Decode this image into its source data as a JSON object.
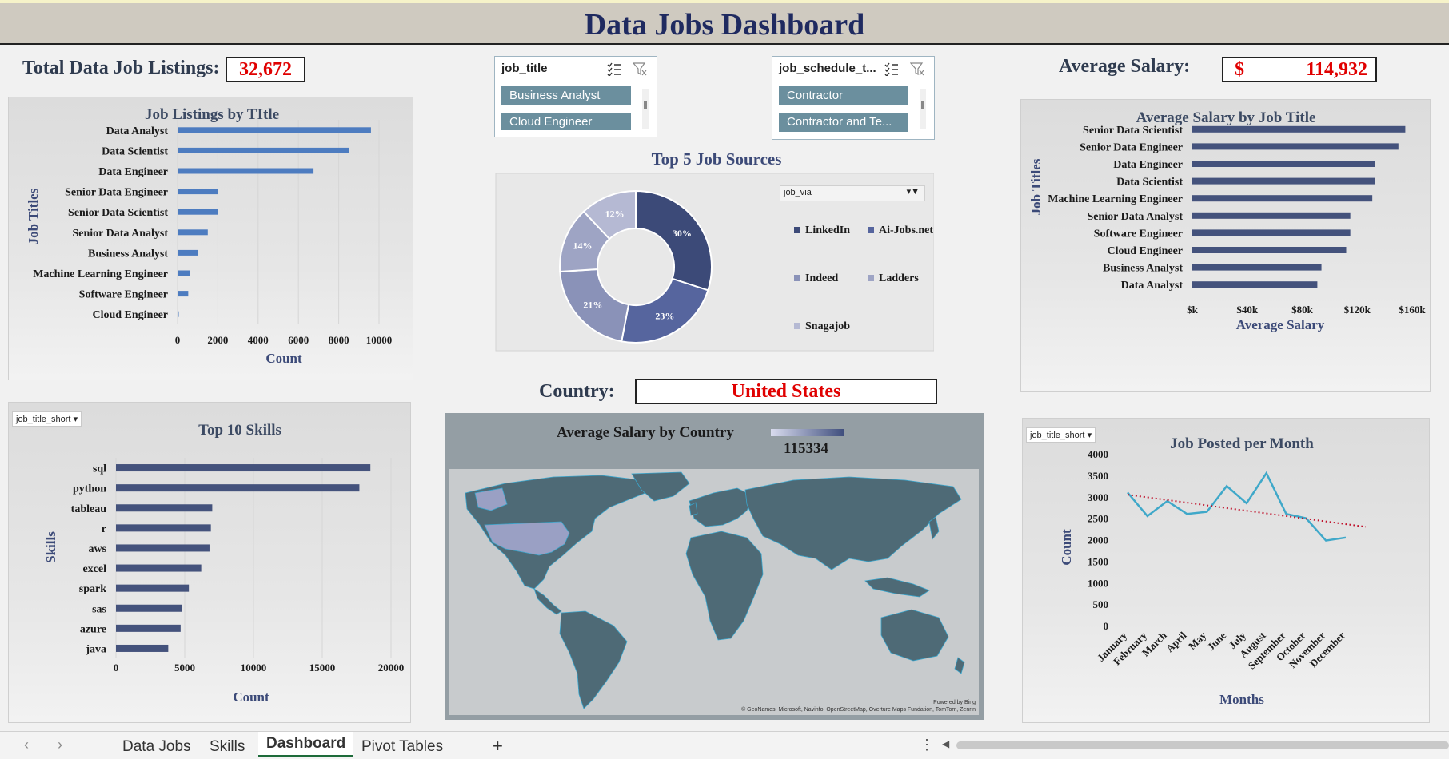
{
  "dashboard_title": "Data Jobs Dashboard",
  "kpis": {
    "total_label": "Total Data Job Listings:",
    "total_value": "32,672",
    "avg_salary_label": "Average Salary:",
    "avg_salary_currency": "$",
    "avg_salary_value": "114,932",
    "country_label": "Country:",
    "country_value": "United States"
  },
  "slicers": {
    "job_title": {
      "header": "job_title",
      "items": [
        "Business Analyst",
        "Cloud Engineer"
      ]
    },
    "job_schedule": {
      "header": "job_schedule_t...",
      "items": [
        "Contractor",
        "Contractor and Te..."
      ]
    }
  },
  "filter_chips": {
    "job_via": "job_via",
    "skills_filter": "job_title_short",
    "month_filter": "job_title_short"
  },
  "map_panel": {
    "title": "Average Salary by Country",
    "legend_value": "115334",
    "credit_1": "Powered by Bing",
    "credit_2": "© GeoNames, Microsoft, Navinfo, OpenStreetMap, Overture Maps Fundation, TomTom, Zenrin"
  },
  "tabs": [
    "Data Jobs",
    "Skills",
    "Dashboard",
    "Pivot Tables"
  ],
  "active_tab": "Dashboard",
  "new_sheet_label": "+",
  "colors": {
    "bar": "#4d7cc0",
    "bar_dark": "#44527c",
    "accent_red": "#e00000",
    "title_navy": "#1f2a60",
    "slicer_item": "#6b8f9e",
    "map_land": "#4e6a76",
    "map_highlight": "#9aa0c4",
    "line": "#3fa8c9",
    "trend": "#c0102a"
  },
  "chart_data": [
    {
      "id": "job_listings_by_title",
      "type": "bar",
      "orientation": "horizontal",
      "title": "Job Listings by TItle",
      "xlabel": "Count",
      "ylabel": "Job Titles",
      "categories": [
        "Data Analyst",
        "Data Scientist",
        "Data Engineer",
        "Senior Data Engineer",
        "Senior Data Scientist",
        "Senior Data Analyst",
        "Business Analyst",
        "Machine Learning Engineer",
        "Software Engineer",
        "Cloud Engineer"
      ],
      "values": [
        9600,
        8500,
        6750,
        2000,
        2000,
        1500,
        1000,
        600,
        530,
        50
      ],
      "xticks": [
        "0",
        "2000",
        "4000",
        "6000",
        "8000",
        "10000"
      ],
      "xlim": [
        0,
        10000
      ]
    },
    {
      "id": "top_10_skills",
      "type": "bar",
      "orientation": "horizontal",
      "title": "Top 10 Skills",
      "xlabel": "Count",
      "ylabel": "Skills",
      "categories": [
        "sql",
        "python",
        "tableau",
        "r",
        "aws",
        "excel",
        "spark",
        "sas",
        "azure",
        "java"
      ],
      "values": [
        18500,
        17700,
        7000,
        6900,
        6800,
        6200,
        5300,
        4800,
        4700,
        3800
      ],
      "xticks": [
        "0",
        "5000",
        "10000",
        "15000",
        "20000"
      ],
      "xlim": [
        0,
        20000
      ]
    },
    {
      "id": "top_5_job_sources",
      "type": "pie",
      "donut": true,
      "title": "Top 5 Job Sources",
      "categories": [
        "LinkedIn",
        "Ai-Jobs.net",
        "Indeed",
        "Ladders",
        "Snagajob"
      ],
      "values": [
        30,
        23,
        21,
        14,
        12
      ],
      "labels": [
        "30%",
        "23%",
        "21%",
        "14%",
        "12%"
      ],
      "colors": [
        "#3c4a78",
        "#56659e",
        "#8a92b8",
        "#9ea4c4",
        "#b5b9d3"
      ],
      "legend": "right"
    },
    {
      "id": "avg_salary_by_title",
      "type": "bar",
      "orientation": "horizontal",
      "title": "Average Salary by Job Title",
      "xlabel": "Average Salary",
      "ylabel": "Job Titles",
      "categories": [
        "Senior Data Scientist",
        "Senior Data Engineer",
        "Data Engineer",
        "Data Scientist",
        "Machine Learning Engineer",
        "Senior Data Analyst",
        "Software Engineer",
        "Cloud Engineer",
        "Business Analyst",
        "Data Analyst"
      ],
      "values": [
        155000,
        150000,
        133000,
        133000,
        131000,
        115000,
        115000,
        112000,
        94000,
        91000
      ],
      "xticks": [
        "$k",
        "$40k",
        "$80k",
        "$120k",
        "$160k"
      ],
      "xlim": [
        0,
        160000
      ]
    },
    {
      "id": "jobs_posted_per_month",
      "type": "line",
      "title": "Job Posted per Month",
      "xlabel": "Months",
      "ylabel": "Count",
      "categories": [
        "January",
        "February",
        "March",
        "April",
        "May",
        "June",
        "July",
        "August",
        "September",
        "October",
        "November",
        "December"
      ],
      "values": [
        3100,
        2550,
        2900,
        2600,
        2650,
        3250,
        2850,
        3550,
        2600,
        2500,
        1980,
        2050
      ],
      "trendline": [
        3050,
        2300
      ],
      "yticks": [
        "4000",
        "3500",
        "3000",
        "2500",
        "2000",
        "1500",
        "1000",
        "500",
        "0"
      ],
      "ylim": [
        0,
        4000
      ]
    }
  ]
}
